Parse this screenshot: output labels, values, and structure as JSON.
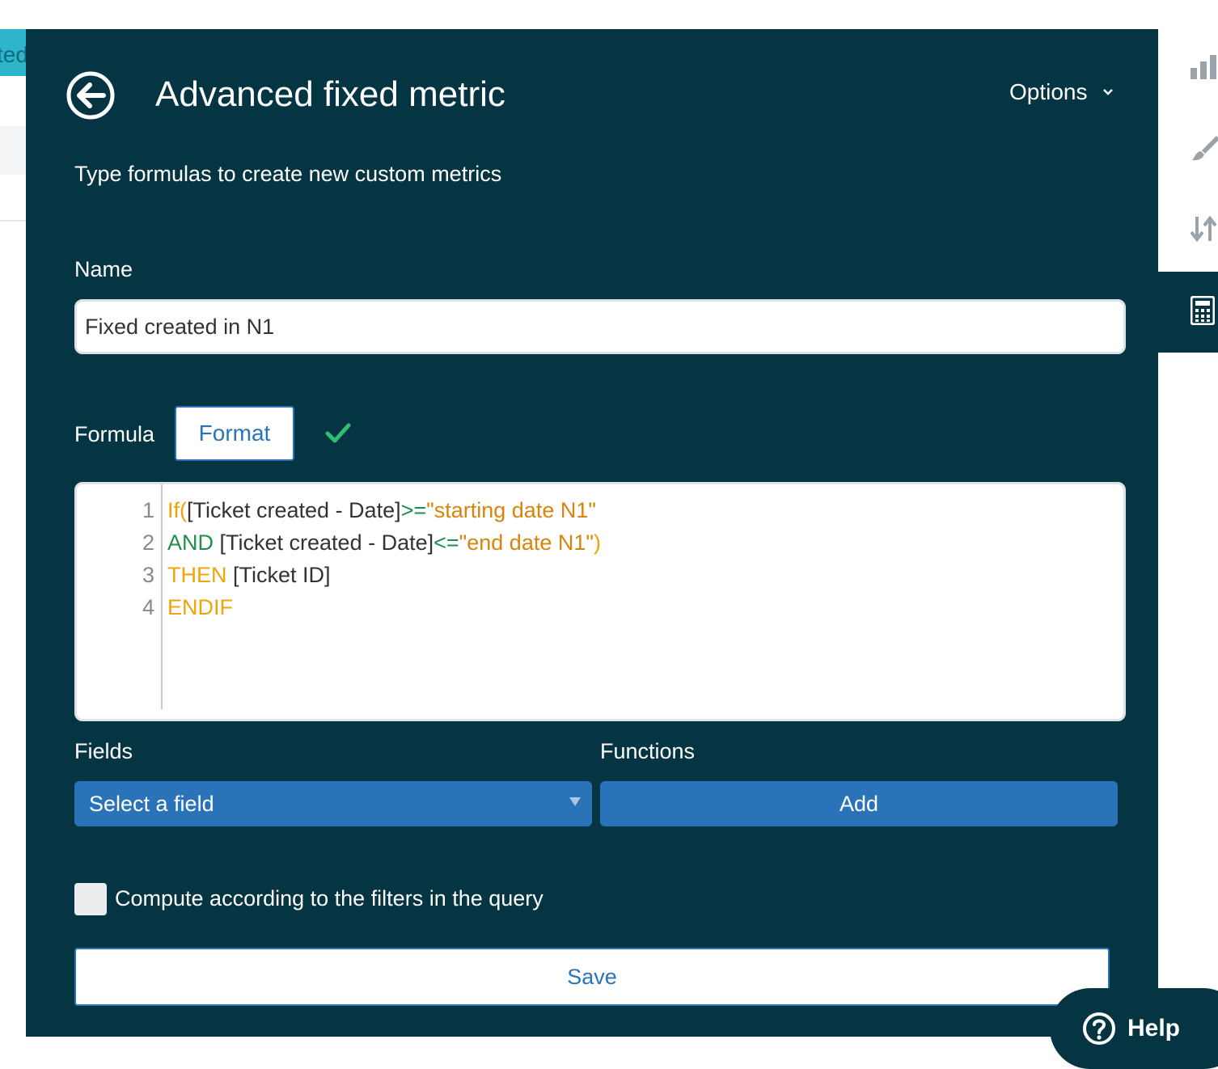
{
  "background": {
    "tab_text": "ted"
  },
  "panel": {
    "title": "Advanced fixed metric",
    "options_label": "Options",
    "subtitle": "Type formulas to create new custom metrics",
    "name_label": "Name",
    "name_value": "Fixed created in N1",
    "formula_label": "Formula",
    "format_button": "Format",
    "formula_status": "valid",
    "formula_lines": [
      {
        "number": "1",
        "tokens": [
          {
            "t": "If(",
            "c": "k-or"
          },
          {
            "t": "[Ticket created - Date]",
            "c": "k-tx"
          },
          {
            "t": ">=",
            "c": "k-gr"
          },
          {
            "t": "\"starting date N1\"",
            "c": "k-st"
          }
        ]
      },
      {
        "number": "2",
        "tokens": [
          {
            "t": "AND",
            "c": "k-gr"
          },
          {
            "t": " [Ticket created - Date]",
            "c": "k-tx"
          },
          {
            "t": "<=",
            "c": "k-gr"
          },
          {
            "t": "\"end date N1\"",
            "c": "k-st"
          },
          {
            "t": ")",
            "c": "k-or"
          }
        ]
      },
      {
        "number": "3",
        "tokens": [
          {
            "t": "THEN",
            "c": "k-or"
          },
          {
            "t": " [Ticket ID]",
            "c": "k-tx"
          }
        ]
      },
      {
        "number": "4",
        "tokens": [
          {
            "t": "ENDIF",
            "c": "k-or"
          }
        ]
      }
    ],
    "fields_label": "Fields",
    "fields_select": "Select a field",
    "functions_label": "Functions",
    "add_button": "Add",
    "compute_checkbox_checked": false,
    "compute_label": "Compute according to the filters in the query",
    "save_button": "Save"
  },
  "toolbar": {
    "icons": [
      "bar-chart-icon",
      "paintbrush-icon",
      "sort-icon",
      "calculator-icon"
    ],
    "active": "calculator-icon"
  },
  "help": {
    "label": "Help"
  },
  "colors": {
    "panel_bg": "#053542",
    "accent_blue": "#2a73b8",
    "check_green": "#2fbf71"
  }
}
